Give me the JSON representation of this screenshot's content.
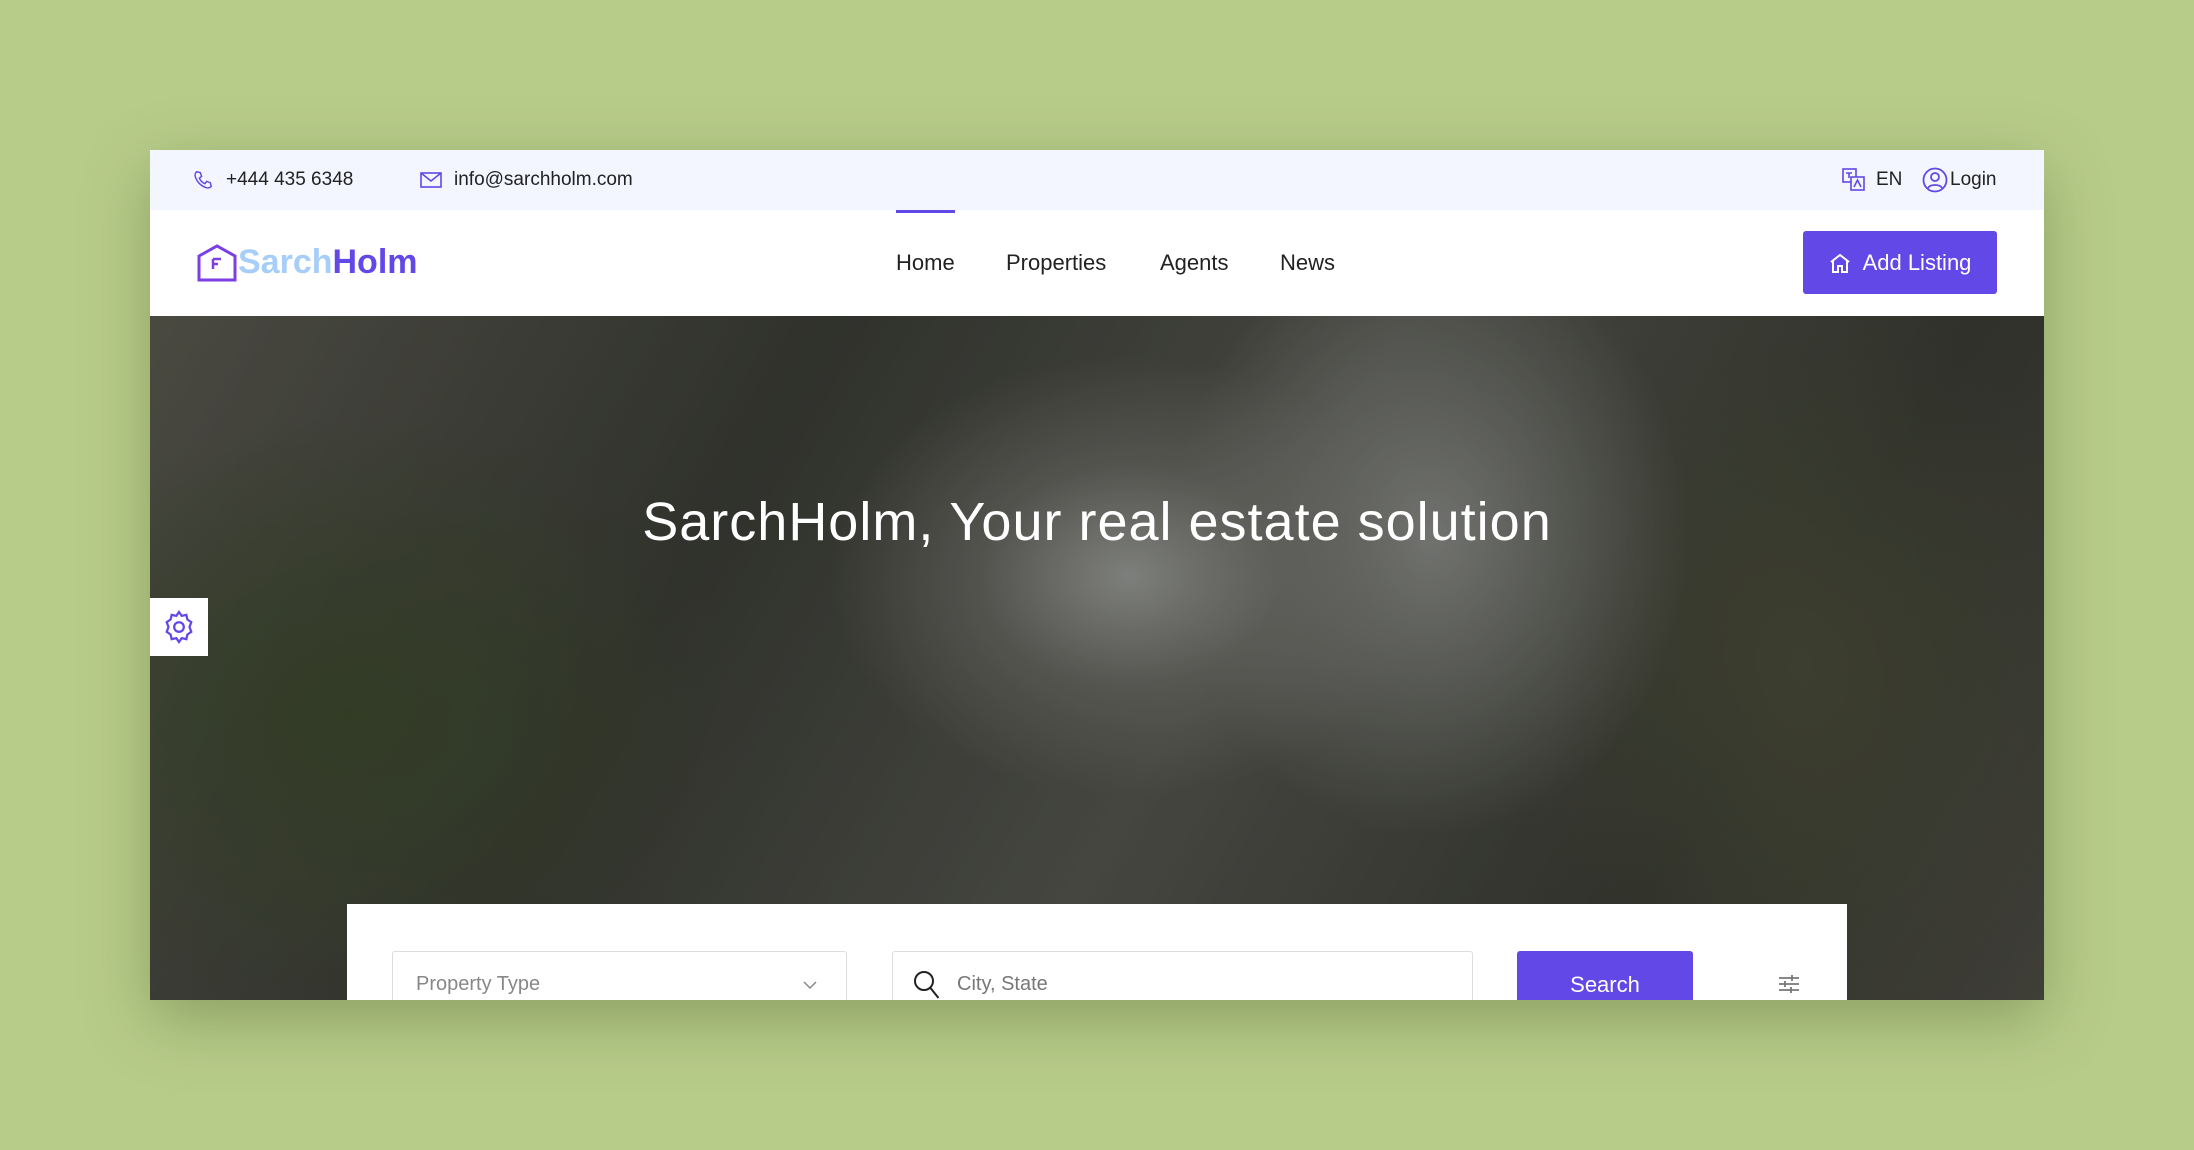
{
  "topbar": {
    "phone": "+444 435 6348",
    "email": "info@sarchholm.com",
    "language": "EN",
    "login": "Login"
  },
  "logo": {
    "part1": "Sarch",
    "part2": "Holm"
  },
  "nav": {
    "items": [
      {
        "label": "Home",
        "active": true
      },
      {
        "label": "Properties"
      },
      {
        "label": "Agents"
      },
      {
        "label": "News"
      }
    ],
    "add_listing": "Add Listing"
  },
  "hero": {
    "title": "SarchHolm, Your real estate solution"
  },
  "search": {
    "property_type_placeholder": "Property Type",
    "city_placeholder": "City, State",
    "button": "Search"
  },
  "colors": {
    "accent": "#6248e6",
    "logo_light": "#a7cdf9",
    "topbar_bg": "#f3f6fe"
  }
}
